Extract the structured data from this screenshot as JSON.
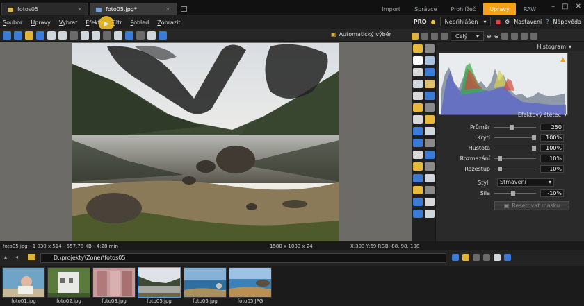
{
  "titlebar": {
    "tabs": [
      {
        "label": "fotos05",
        "active": false
      },
      {
        "label": "foto05.jpg*",
        "active": true
      }
    ],
    "modes": [
      {
        "label": "Import",
        "active": false
      },
      {
        "label": "Správce",
        "active": false
      },
      {
        "label": "Prohlížeč",
        "active": false
      },
      {
        "label": "Úpravy",
        "active": true
      },
      {
        "label": "RAW",
        "active": false
      }
    ]
  },
  "menubar": {
    "items": [
      "Soubor",
      "Úpravy",
      "Vybrat",
      "Efekty",
      "Filtr",
      "Pohled",
      "Zobrazit"
    ],
    "right": {
      "pro_label": "PRO",
      "pro_dropdown": "Nepřihlášen",
      "settings": "Nastavení",
      "help": "Nápověda"
    }
  },
  "toolbar": {
    "auto_label": "Automatický výběr",
    "zoom_dropdown": "Celý"
  },
  "panel": {
    "histogram_title": "Histogram",
    "effects_title": "Efektový štětec",
    "sliders": [
      {
        "label": "Průměr",
        "value": "250",
        "fraction": 0.4
      },
      {
        "label": "Krytí",
        "value": "100%",
        "fraction": 1.0
      },
      {
        "label": "Hustota",
        "value": "100%",
        "fraction": 1.0
      },
      {
        "label": "Rozmazání",
        "value": "10%",
        "fraction": 0.1
      },
      {
        "label": "Rozestup",
        "value": "10%",
        "fraction": 0.1
      }
    ],
    "style_label": "Styl:",
    "style_value": "Stmavení",
    "strength_label": "Síla",
    "strength_value": "-10%",
    "strength_fraction": 0.45,
    "apply_label": "Resetovat masku"
  },
  "status": {
    "file": "foto05.jpg - 1 030 x 514 - 557,78 KB - 4:28 min",
    "dims": "1580 x 1080 x 24",
    "pixel": "X:303 Y:69  RGB: 88, 98, 108"
  },
  "filmbar": {
    "path": "D:\\projekty\\Zoner\\fotos05"
  },
  "thumbnails": [
    {
      "caption": "foto01.jpg",
      "selected": false
    },
    {
      "caption": "foto02.jpg",
      "selected": false
    },
    {
      "caption": "foto03.jpg",
      "selected": false
    },
    {
      "caption": "foto05.jpg",
      "selected": true
    },
    {
      "caption": "foto05.jpg",
      "selected": false
    },
    {
      "caption": "foto05.JPG",
      "selected": false
    }
  ],
  "colors": {
    "accent": "#f5a11a",
    "selection": "#5aa0e6",
    "panel_bg": "#2a2a2a"
  }
}
